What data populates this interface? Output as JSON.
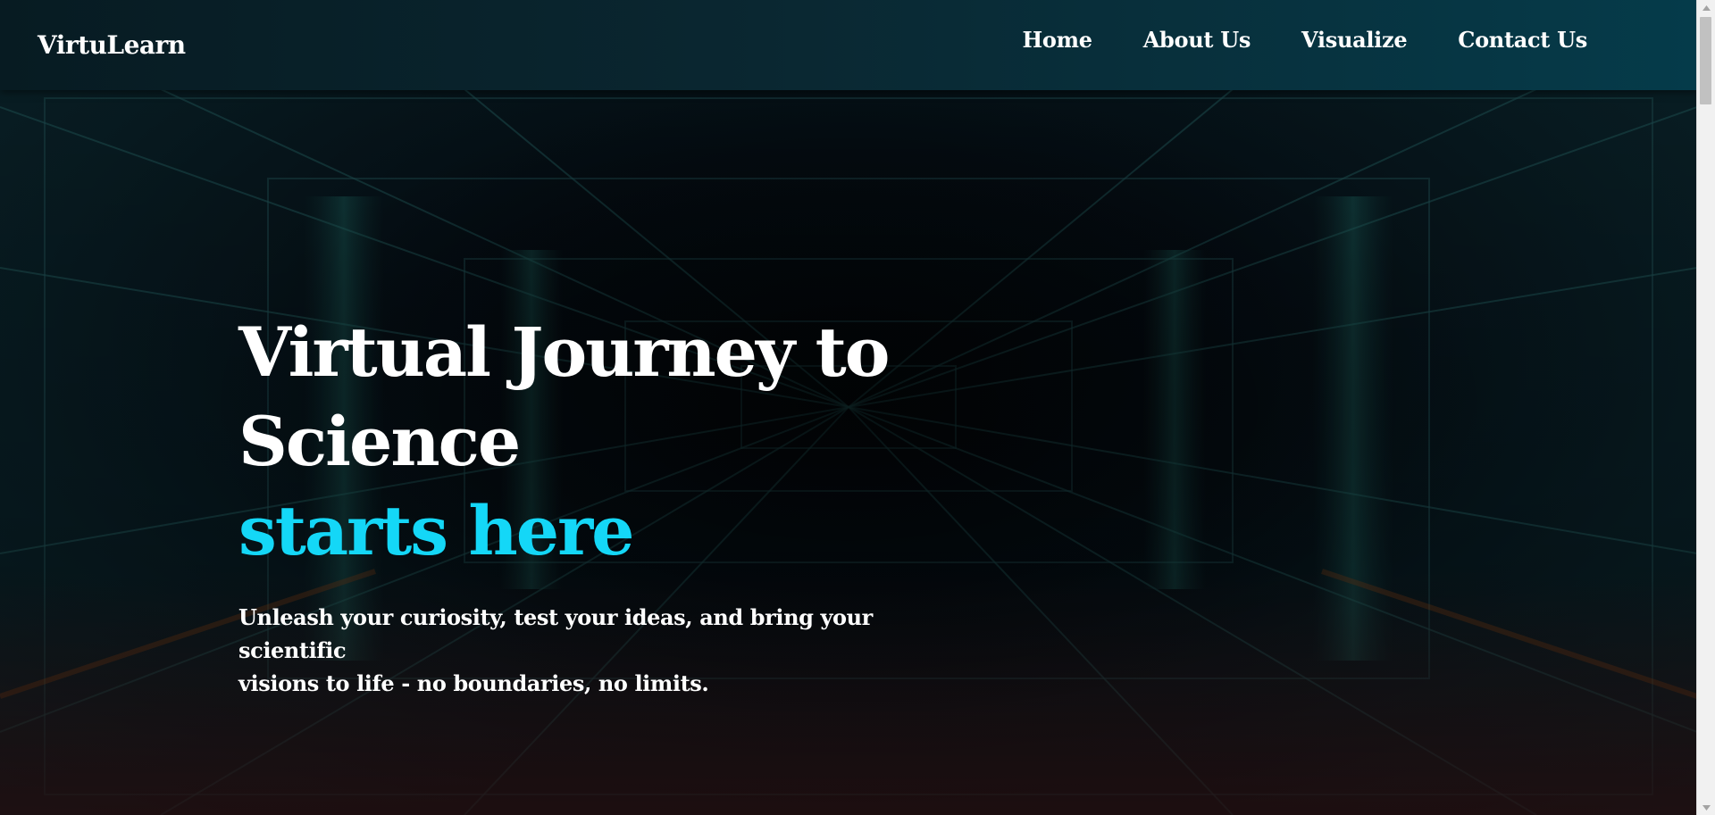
{
  "brand": {
    "name": "VirtuLearn"
  },
  "nav": {
    "items": [
      {
        "label": "Home"
      },
      {
        "label": "About Us"
      },
      {
        "label": "Visualize"
      },
      {
        "label": "Contact Us"
      }
    ]
  },
  "hero": {
    "title_line1": "Virtual Journey to",
    "title_line2": "Science",
    "title_accent": "starts here",
    "subtitle_line1": "Unleash your curiosity, test your ideas, and bring your scientific",
    "subtitle_line2": "visions to life - no boundaries, no limits."
  },
  "colors": {
    "accent": "#14d7f7",
    "text": "#ffffff",
    "navbar_start": "#071b22",
    "navbar_end": "#053b4a",
    "background": "#03080d"
  },
  "icons": {
    "scroll_up": "triangle-up-icon",
    "scroll_down": "triangle-down-icon"
  }
}
